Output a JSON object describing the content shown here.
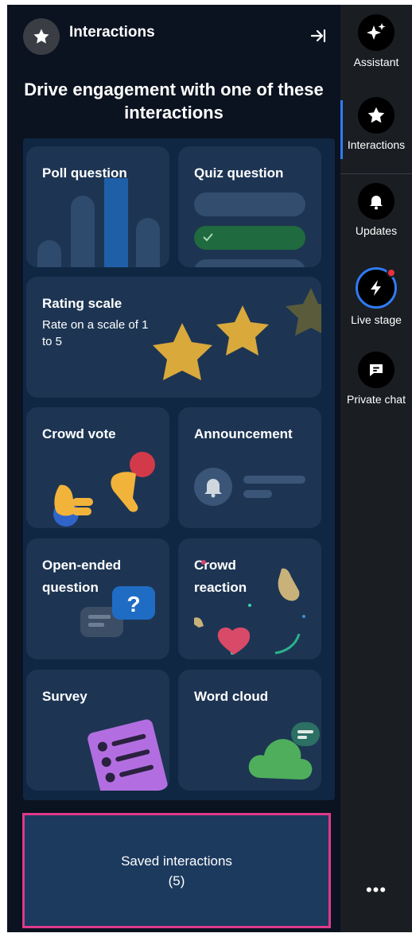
{
  "header": {
    "title": "Interactions",
    "headline": "Drive engagement with one of these interactions"
  },
  "cards": {
    "poll": {
      "label": "Poll question"
    },
    "quiz": {
      "label": "Quiz question"
    },
    "rating": {
      "label": "Rating scale",
      "description": "Rate on a scale of 1 to 5"
    },
    "crowd_vote": {
      "label": "Crowd vote"
    },
    "announcement": {
      "label": "Announcement"
    },
    "open_ended": {
      "label": "Open-ended question"
    },
    "crowd_reaction": {
      "label": "Crowd reaction"
    },
    "survey": {
      "label": "Survey"
    },
    "word_cloud": {
      "label": "Word cloud"
    }
  },
  "saved": {
    "label": "Saved interactions (5)"
  },
  "rail": {
    "items": [
      {
        "label": "Assistant",
        "icon": "sparkle-icon"
      },
      {
        "label": "Interactions",
        "icon": "star-icon",
        "active": true
      },
      {
        "label": "Updates",
        "icon": "bell-icon"
      },
      {
        "label": "Live stage",
        "icon": "lightning-icon",
        "notification": true
      },
      {
        "label": "Private chat",
        "icon": "chat-icon"
      }
    ],
    "more_label": "•••"
  },
  "colors": {
    "panel_bg": "#0b1220",
    "card_bg": "#1d3553",
    "rail_bg": "#1a1d22",
    "active_accent": "#2f7cf6",
    "highlight_border": "#e0398b",
    "notification_dot": "#e8323c"
  }
}
